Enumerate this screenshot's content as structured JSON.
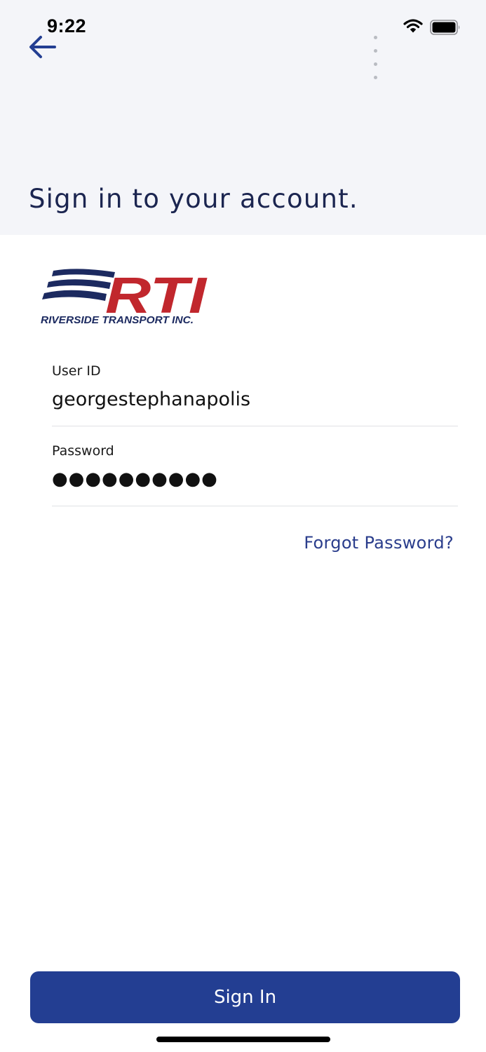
{
  "status_bar": {
    "time": "9:22",
    "icons": [
      "cellular-signal-icon",
      "wifi-icon",
      "battery-icon"
    ]
  },
  "header": {
    "back_icon": "arrow-left-icon",
    "title": "Sign in to your account."
  },
  "logo": {
    "text": "RTI",
    "tagline": "RIVERSIDE TRANSPORT INC.",
    "colors": {
      "navy": "#1c2a60",
      "red": "#c1272d"
    }
  },
  "form": {
    "user_id": {
      "label": "User ID",
      "value": "georgestephanapolis"
    },
    "password": {
      "label": "Password",
      "masked_value": "●●●●●●●●●●"
    },
    "forgot_label": "Forgot Password?"
  },
  "footer": {
    "signin_label": "Sign In"
  },
  "colors": {
    "accent": "#233e92",
    "title": "#1b2550",
    "header_bg": "#f4f5f9",
    "link": "#2a3d8c"
  }
}
